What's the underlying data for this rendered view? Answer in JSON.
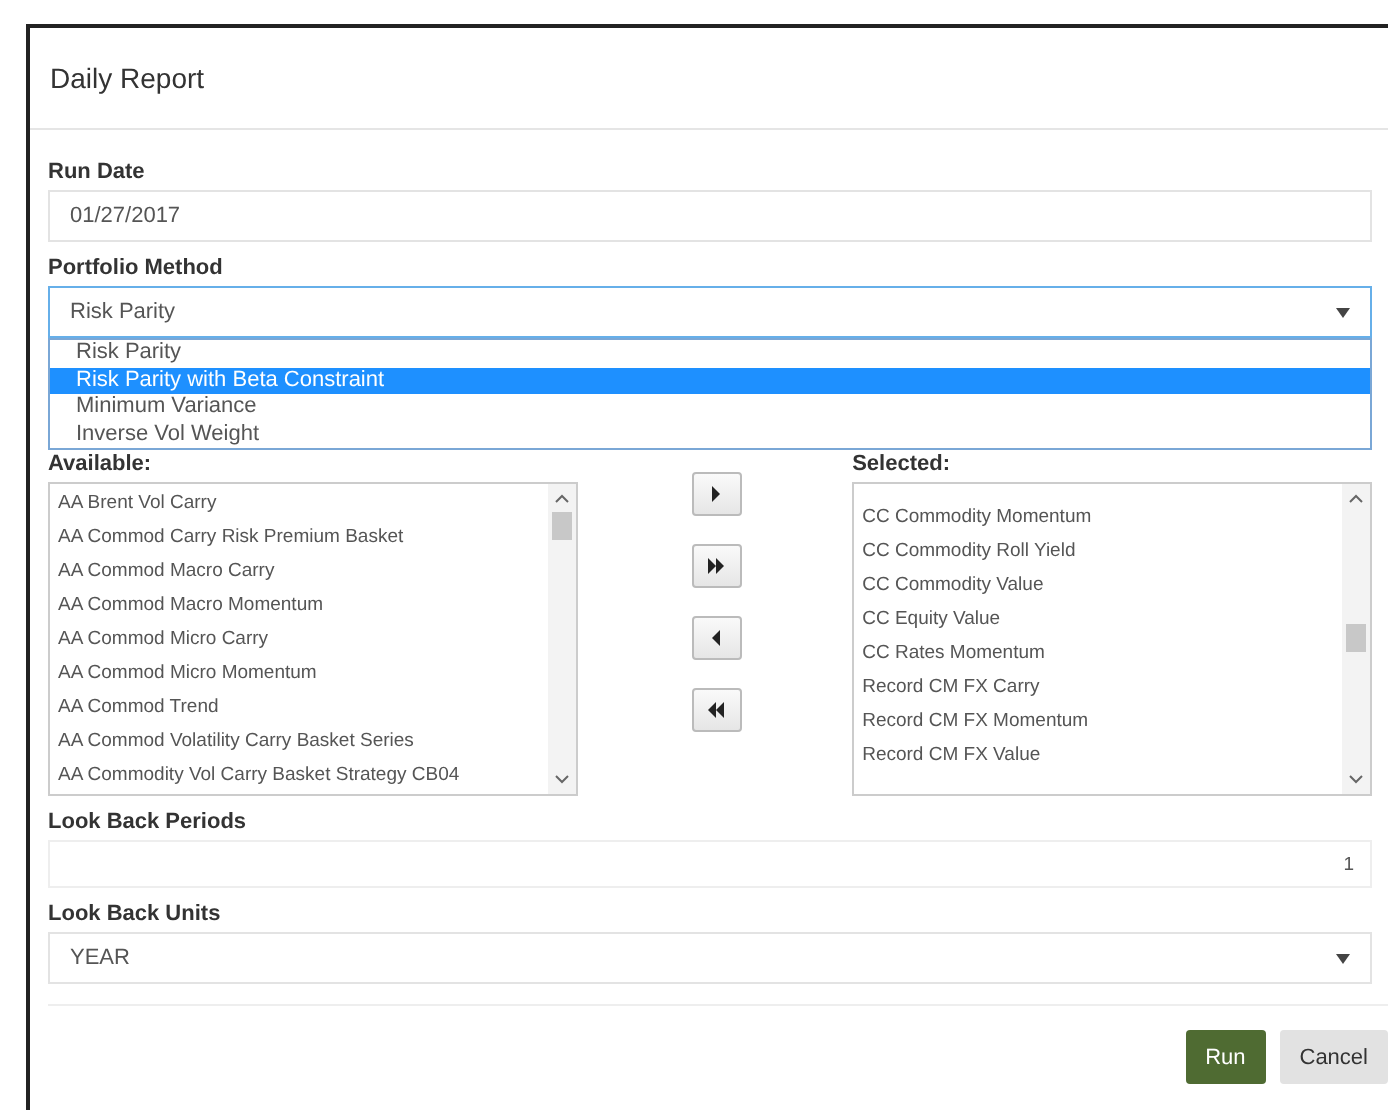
{
  "dialog": {
    "title": "Daily Report"
  },
  "run_date": {
    "label": "Run Date",
    "value": "01/27/2017"
  },
  "portfolio_method": {
    "label": "Portfolio Method",
    "value": "Risk Parity",
    "expanded": true,
    "options": [
      {
        "label": "Risk Parity",
        "highlighted": false
      },
      {
        "label": "Risk Parity with Beta Constraint",
        "highlighted": true
      },
      {
        "label": "Minimum Variance",
        "highlighted": false
      },
      {
        "label": "Inverse Vol Weight",
        "highlighted": false
      }
    ]
  },
  "available": {
    "label": "Available:",
    "items": [
      "AA Brent Vol Carry",
      "AA Commod Carry Risk Premium Basket",
      "AA Commod Macro Carry",
      "AA Commod Macro Momentum",
      "AA Commod Micro Carry",
      "AA Commod Micro Momentum",
      "AA Commod Trend",
      "AA Commod Volatility Carry Basket Series",
      "AA Commodity Vol Carry Basket Strategy CB04"
    ]
  },
  "selected": {
    "label": "Selected:",
    "items": [
      "CC Commodity Momentum",
      "CC Commodity Roll Yield",
      "CC Commodity Value",
      "CC Equity Value",
      "CC Rates Momentum",
      "Record CM FX Carry",
      "Record CM FX Momentum",
      "Record CM FX Value"
    ]
  },
  "move_buttons": [
    {
      "kind": "one-right"
    },
    {
      "kind": "all-right"
    },
    {
      "kind": "one-left"
    },
    {
      "kind": "all-left"
    }
  ],
  "look_back_periods": {
    "label": "Look Back Periods",
    "value": "1"
  },
  "look_back_units": {
    "label": "Look Back Units",
    "value": "YEAR"
  },
  "buttons": [
    {
      "label": "Run",
      "kind": "primary"
    },
    {
      "label": "Cancel",
      "kind": "secondary"
    }
  ]
}
